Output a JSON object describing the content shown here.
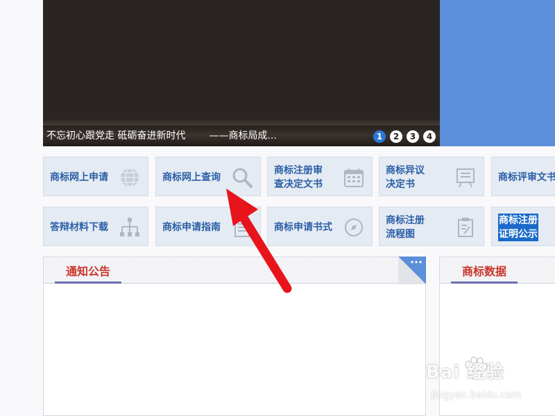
{
  "banner": {
    "caption": "不忘初心跟党走 砥砺奋进新时代",
    "source": "——商标局成...",
    "dots": [
      "1",
      "2",
      "3",
      "4"
    ],
    "active_dot": 0
  },
  "tiles_row1": [
    {
      "label": "商标网上申请",
      "icon": "globe-icon"
    },
    {
      "label": "商标网上查询",
      "icon": "magnifier-icon"
    },
    {
      "label1": "商标注册审",
      "label2": "查决定文书",
      "icon": "calendar-icon"
    },
    {
      "label1": "商标异议",
      "label2": "决定书",
      "icon": "easel-icon"
    },
    {
      "label": "商标评审文书",
      "icon": ""
    }
  ],
  "tiles_row2": [
    {
      "label": "答辩材料下载",
      "icon": "sitemap-icon"
    },
    {
      "label": "商标申请指南",
      "icon": "document-icon"
    },
    {
      "label": "商标申请书式",
      "icon": "compass-icon"
    },
    {
      "label1": "商标注册",
      "label2": "流程图",
      "icon": "edit-document-icon"
    },
    {
      "label1": "商标注册",
      "label2": "证明公示",
      "icon": ""
    }
  ],
  "panels": {
    "notice_title": "通知公告",
    "data_title": "商标数据"
  },
  "watermark": {
    "brand": "Bai  经验",
    "sub": "jingyan.baidu.com"
  },
  "colors": {
    "tile_text": "#2b5fa6",
    "panel_title": "#c8342a",
    "arrow": "#e8141b",
    "blue_panel": "#5b8fd9"
  }
}
